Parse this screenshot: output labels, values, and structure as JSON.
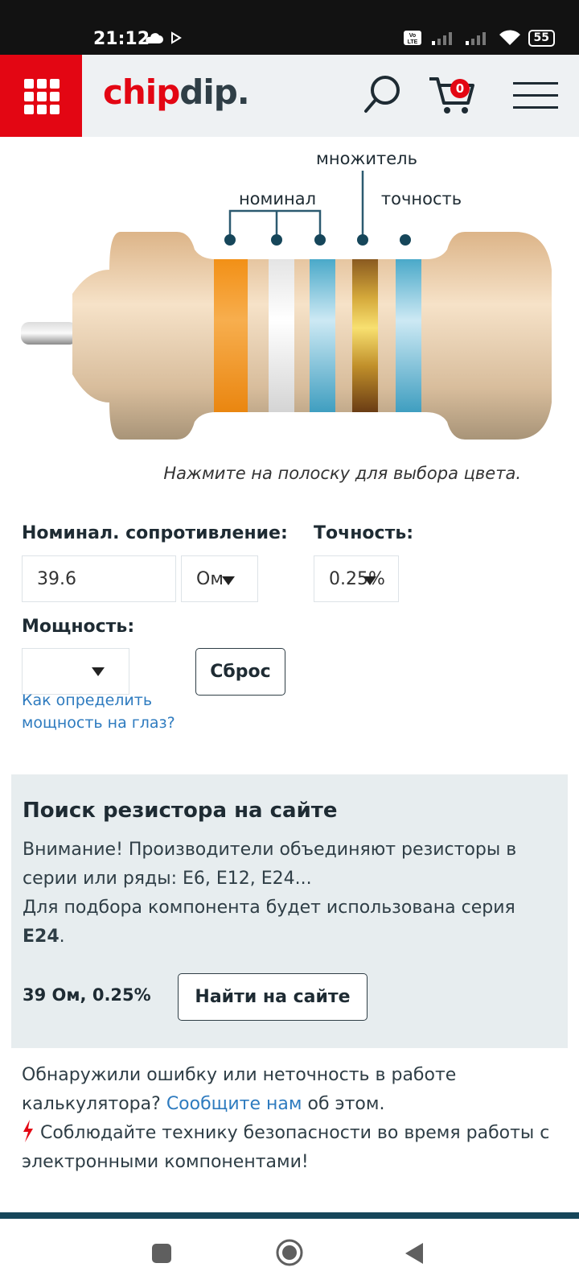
{
  "status": {
    "time": "21:12",
    "battery": "55",
    "network": "LTE"
  },
  "header": {
    "logo_chip": "chip",
    "logo_dip": "dip.",
    "cart_count": "0"
  },
  "diagram": {
    "label_nominal": "номинал",
    "label_multiplier": "множитель",
    "label_accuracy": "точность",
    "band_colors": [
      "#f39a1e",
      "#f2f2f2",
      "#5fb3cf",
      "#b0822a",
      "#5fb3cf"
    ],
    "caption": "Нажмите на полоску для выбора цвета."
  },
  "form": {
    "nominal_label": "Номинал. сопротивление:",
    "nominal_value": "39.6",
    "unit_value": "Ом",
    "accuracy_label": "Точность:",
    "accuracy_value": "0.25%",
    "power_label": "Мощность:",
    "power_value": "",
    "reset_button": "Сброс",
    "help_link": "Как определить мощность на глаз?"
  },
  "search": {
    "title": "Поиск резистора на сайте",
    "text1": "Внимание! Производители объединяют резисторы в серии или ряды: E6, E12, E24...",
    "text2": "Для подбора компонента будет использована серия",
    "series": "E24",
    "text2_end": ".",
    "result": "39 Ом, 0.25%",
    "find_button": "Найти на сайте"
  },
  "footer": {
    "error_text1": "Обнаружили ошибку или неточность в работе калькулятора?",
    "report_link": "Сообщите нам",
    "error_text2": "об этом.",
    "safety_text": "Соблюдайте технику безопасности во время работы с электронными компонентами!"
  },
  "colors": {
    "brand_red": "#e30613",
    "link_blue": "#2e7bbf",
    "panel_bg": "#e7edef"
  }
}
